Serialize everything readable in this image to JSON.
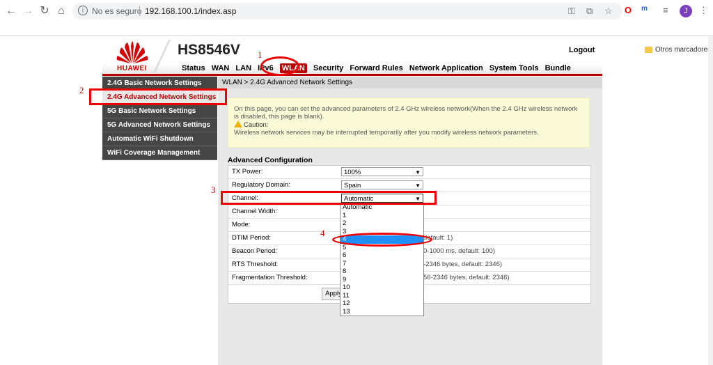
{
  "browser": {
    "security_label": "No es seguro",
    "url": "192.168.100.1/index.asp",
    "bookmarks_folder": "Otros marcadores",
    "avatar_letter": "J"
  },
  "router": {
    "brand": "HUAWEI",
    "model": "HS8546V",
    "logout": "Logout",
    "menu": [
      "Status",
      "WAN",
      "LAN",
      "IPv6",
      "WLAN",
      "Security",
      "Forward Rules",
      "Network Application",
      "System Tools",
      "Bundle"
    ],
    "menu_active": "WLAN",
    "sidebar": [
      "2.4G Basic Network Settings",
      "2.4G Advanced Network Settings",
      "5G Basic Network Settings",
      "5G Advanced Network Settings",
      "Automatic WiFi Shutdown",
      "WiFi Coverage Management"
    ],
    "breadcrumb": "WLAN > 2.4G Advanced Network Settings",
    "notice_text": "On this page, you can set the advanced parameters of 2.4 GHz wireless network(When the 2.4 GHz wireless network is disabled, this page is blank).",
    "caution_label": "Caution:",
    "caution_text": "Wireless network services may be interrupted temporarily after you modify wireless network parameters.",
    "section_title": "Advanced Configuration",
    "rows": [
      {
        "label": "TX Power:",
        "value": "100%",
        "note": ""
      },
      {
        "label": "Regulatory Domain:",
        "value": "Spain",
        "note": ""
      },
      {
        "label": "Channel:",
        "value": "Automatic",
        "note": ""
      },
      {
        "label": "Channel Width:",
        "value": "",
        "note": ""
      },
      {
        "label": "Mode:",
        "value": "",
        "note": ""
      },
      {
        "label": "DTIM Period:",
        "value": "",
        "note": "default: 1)"
      },
      {
        "label": "Beacon Period:",
        "value": "",
        "note": "0-1000 ms, default: 100)"
      },
      {
        "label": "RTS Threshold:",
        "value": "",
        "note": "-2346 bytes, default: 2346)"
      },
      {
        "label": "Fragmentation Threshold:",
        "value": "",
        "note": "56-2346 bytes, default: 2346)"
      }
    ],
    "apply_label": "Apply",
    "channel_options": [
      "Automatic",
      "1",
      "2",
      "3",
      "4",
      "5",
      "6",
      "7",
      "8",
      "9",
      "10",
      "11",
      "12",
      "13"
    ],
    "channel_highlighted": "4"
  },
  "annotations": [
    "1",
    "2",
    "3",
    "4"
  ],
  "colors": {
    "accent": "#b80000",
    "highlight": "#1e90ff",
    "annotation": "#e00000"
  }
}
